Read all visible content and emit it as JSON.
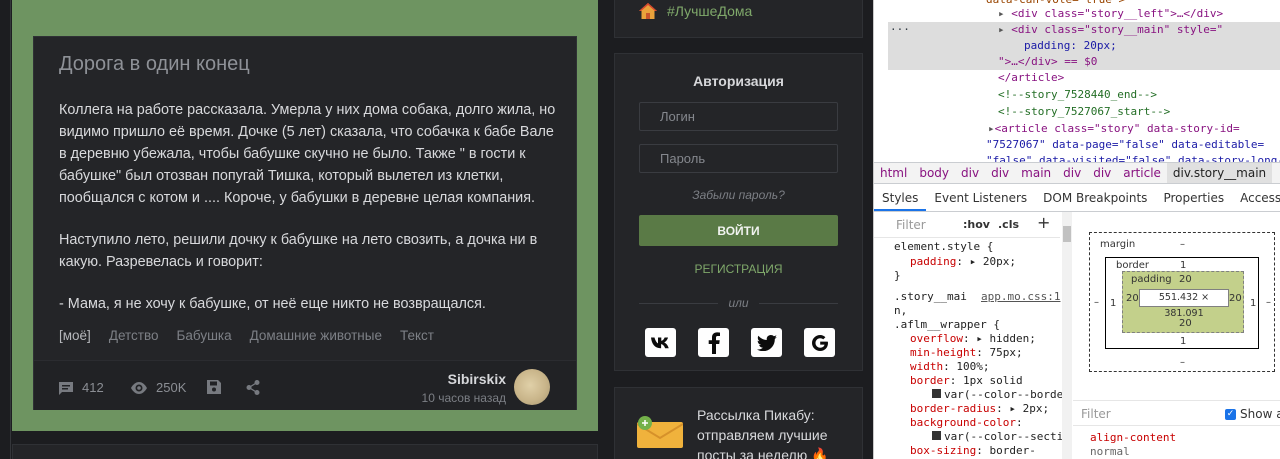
{
  "story": {
    "title": "Дорога в один конец",
    "paragraphs": [
      "Коллега на работе рассказала. Умерла у них дома собака, долго жила, но видимо пришло её время. Дочке (5 лет) сказала, что собачка к бабе Вале в деревню убежала, чтобы бабушке скучно не было. Также \" в гости к бабушке\" был отозван попугай Тишка, который вылетел из клетки, пообщался с котом и .... Короче, у бабушки в деревне целая компания.",
      "Наступило лето, решили дочку к бабушке на лето свозить, а дочка ни в какую. Разревелась и говорит:",
      "- Мама, я не хочу к бабушке, от неё еще никто не возвращался."
    ],
    "tags": [
      "[моё]",
      "Детство",
      "Бабушка",
      "Домашние животные",
      "Текст"
    ],
    "comments": "412",
    "views": "250K",
    "author": "Sibirskix",
    "time": "10 часов назад"
  },
  "sidebar": {
    "hashtag": "#ЛучшеДома",
    "auth_title": "Авторизация",
    "login_placeholder": "Логин",
    "password_placeholder": "Пароль",
    "forgot": "Забыли пароль?",
    "login_button": "ВОЙТИ",
    "register": "РЕГИСТРАЦИЯ",
    "or": "или",
    "socials": [
      {
        "icon": "vk-icon",
        "glyph": "vk"
      },
      {
        "icon": "facebook-icon",
        "glyph": "f"
      },
      {
        "icon": "twitter-icon",
        "glyph": "🐦"
      },
      {
        "icon": "google-icon",
        "glyph": "G"
      }
    ],
    "newsletter_text": "Рассылка Пикабу: отправляем лучшие посты за неделю 🔥"
  },
  "devtools": {
    "dom_lines": [
      {
        "text": "data-can-vote=\"true\">"
      },
      {
        "text": "<div class=\"story__left\">…</div>"
      },
      {
        "text": "<div class=\"story__main\" style=\""
      },
      {
        "text": "padding: 20px;"
      },
      {
        "text": "\">…</div> == $0"
      },
      {
        "text": "</article>"
      },
      {
        "text": "<!--story_7528440_end-->"
      },
      {
        "text": "<!--story_7527067_start-->"
      },
      {
        "text": "<article class=\"story\" data-story-id="
      },
      {
        "text": "\"7527067\" data-page=\"false\" data-editable="
      },
      {
        "text": "\"false\" data-visited=\"false\" data-story-long-"
      }
    ],
    "breadcrumbs": [
      "html",
      "body",
      "div",
      "div",
      "main",
      "div",
      "div",
      "article",
      "div.story__main"
    ],
    "tabs": [
      "Styles",
      "Event Listeners",
      "DOM Breakpoints",
      "Properties",
      "Accessibility"
    ],
    "filter_placeholder": "Filter",
    "hov": ":hov",
    "cls": ".cls",
    "rules": {
      "element_selector": "element.style {",
      "element_prop": "padding",
      "element_val": "20px;",
      "close": "}",
      "story_selector": ".story__mai",
      "story_selector2": "n,",
      "wrapper_selector": ".aflm__wrapper {",
      "file": "app.mo.css:1",
      "props": [
        {
          "name": "overflow",
          "value": "hidden;"
        },
        {
          "name": "min-height",
          "value": "75px;"
        },
        {
          "name": "width",
          "value": "100%;"
        },
        {
          "name": "border",
          "value": "1px solid"
        },
        {
          "name": "",
          "value": "var(--color--borde"
        },
        {
          "name": "border-radius",
          "value": "2px;"
        },
        {
          "name": "background-color",
          "value": ""
        },
        {
          "name": "",
          "value": "var(--color--secti"
        },
        {
          "name": "box-sizing",
          "value": "border-"
        }
      ]
    },
    "box_model": {
      "margin_label": "margin",
      "margin_val": "–",
      "border_label": "border",
      "border_val": "1",
      "padding_label": "padding",
      "padding_val": "20",
      "content": "551.432 × 381.091",
      "side_margin": "–",
      "side_border": "1",
      "side_padding": "20"
    },
    "filter2_placeholder": "Filter",
    "show_all": "Show all",
    "computed_prop": "align-content",
    "computed_val": "normal"
  }
}
